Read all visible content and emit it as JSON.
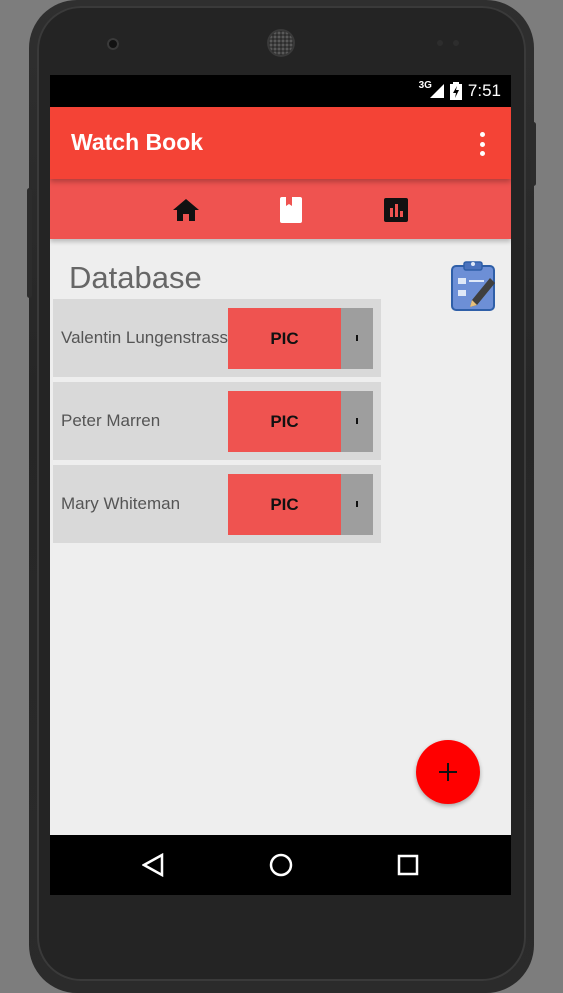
{
  "status_bar": {
    "network": "3G",
    "time": "7:51"
  },
  "app_bar": {
    "title": "Watch Book",
    "menu_icon": "overflow-menu-icon"
  },
  "tabs": [
    {
      "icon": "home-icon",
      "name": "home"
    },
    {
      "icon": "book-icon",
      "name": "book"
    },
    {
      "icon": "chart-icon",
      "name": "stats"
    }
  ],
  "section": {
    "title": "Database",
    "action_icon": "clipboard-edit-icon"
  },
  "rows": [
    {
      "name": "Valentin Lungenstrass",
      "button_label": "PIC"
    },
    {
      "name": "Peter Marren",
      "button_label": "PIC"
    },
    {
      "name": "Mary Whiteman",
      "button_label": "PIC"
    }
  ],
  "fab": {
    "icon": "plus-icon"
  },
  "nav_bar": [
    "back-icon",
    "home-circle-icon",
    "recents-icon"
  ],
  "colors": {
    "primary": "#f44336",
    "tab_bar": "#ef5350",
    "fab": "#ff0000",
    "background": "#eeeeee"
  }
}
